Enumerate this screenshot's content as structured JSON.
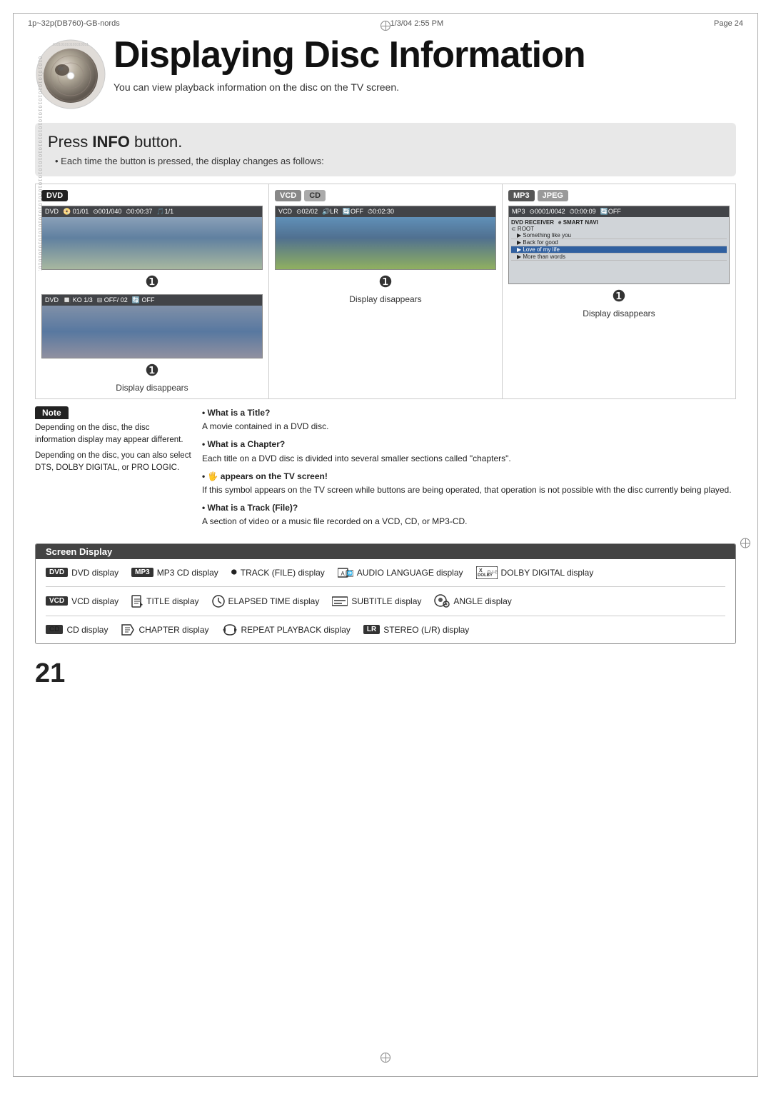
{
  "meta": {
    "filename": "1p~32p(DB760)-GB-nords",
    "date": "1/3/04 2:55 PM",
    "page": "Page 24"
  },
  "page": {
    "number": "21"
  },
  "header": {
    "title": "Displaying Disc Information",
    "subtitle": "You can view playback information on the disc on the TV screen."
  },
  "press_info": {
    "label": "Press ",
    "bold": "INFO",
    "suffix": " button.",
    "bullet": "Each time the button is pressed, the display changes as follows:"
  },
  "panels": [
    {
      "badge": "DVD",
      "badge_class": "badge-dvd",
      "screen1_bar": "DVD  01/01   001/040   0:00:37   1/1",
      "screen2_bar": "DVD  KO 1/3      OFF/ 02   OFF",
      "arrow1": "▼",
      "arrow2": "▼",
      "display_disappears": "Display disappears"
    },
    {
      "badges": [
        "VCD",
        "CD"
      ],
      "badge_classes": [
        "badge-vcd",
        "badge-cd"
      ],
      "screen1_bar": "VCD  02/02   LR   OFF   0:02:30",
      "arrow1": "▼",
      "display_disappears": "Display disappears"
    },
    {
      "badges": [
        "MP3",
        "JPEG"
      ],
      "badge_classes": [
        "badge-mp3",
        "badge-jpeg"
      ],
      "screen1_bar": "MP3  0001/0042   0:00:09   OFF",
      "mp3_columns": [
        "DVD RECEIVER",
        "e SMART NAVI"
      ],
      "mp3_items": [
        "Something like you",
        "Back for good",
        "Love of my life",
        "More than words"
      ],
      "selected_index": 2,
      "arrow1": "▼",
      "display_disappears": "Display disappears"
    }
  ],
  "note": {
    "title": "Note",
    "points": [
      "Depending on the disc, the disc information display may appear different.",
      "Depending on the disc, you can also select DTS, DOLBY DIGITAL, or PRO LOGIC."
    ]
  },
  "facts": [
    {
      "label": "What is a Title?",
      "text": "A movie contained in a DVD disc."
    },
    {
      "label": "What is a Chapter?",
      "text": "Each title on a DVD disc is divided into several smaller sections called \"chapters\"."
    },
    {
      "label": "appears on the TV screen!",
      "icon": "hand-icon",
      "text": "If this symbol appears on the TV screen while buttons are being operated, that operation is not possible with the disc currently being played."
    },
    {
      "label": "What is a Track (File)?",
      "text": "A section of video or a music file recorded on a VCD, CD, or MP3-CD."
    }
  ],
  "screen_display": {
    "header": "Screen Display",
    "rows": [
      [
        {
          "type": "badge",
          "badge": "DVD",
          "badge_class": "badge-dvd",
          "label": "DVD display"
        },
        {
          "type": "badge",
          "badge": "MP3",
          "badge_class": "badge-mp3",
          "label": "MP3 CD display"
        },
        {
          "type": "icon",
          "icon": "●",
          "label": "TRACK (FILE) display"
        },
        {
          "type": "icon",
          "icon": "audio-lang",
          "label": "AUDIO LANGUAGE display"
        },
        {
          "type": "dolby",
          "label": "DOLBY DIGITAL display"
        }
      ],
      [
        {
          "type": "badge",
          "badge": "VCD",
          "badge_class": "badge-vcd",
          "label": "VCD display"
        },
        {
          "type": "icon",
          "icon": "title-icon",
          "label": "TITLE display"
        },
        {
          "type": "icon",
          "icon": "elapsed-icon",
          "label": "ELAPSED TIME display"
        },
        {
          "type": "icon",
          "icon": "subtitle-icon",
          "label": "SUBTITLE display"
        },
        {
          "type": "icon",
          "icon": "angle-icon",
          "label": "ANGLE display"
        }
      ],
      [
        {
          "type": "badge",
          "badge": "CD",
          "badge_class": "badge-cd",
          "label": "CD display"
        },
        {
          "type": "icon",
          "icon": "chapter-icon",
          "label": "CHAPTER display"
        },
        {
          "type": "icon",
          "icon": "repeat-icon",
          "label": "REPEAT PLAYBACK display"
        },
        {
          "type": "badge",
          "badge": "LR",
          "badge_class": "badge-dvd",
          "label": "STEREO (L/R) display"
        }
      ]
    ]
  }
}
